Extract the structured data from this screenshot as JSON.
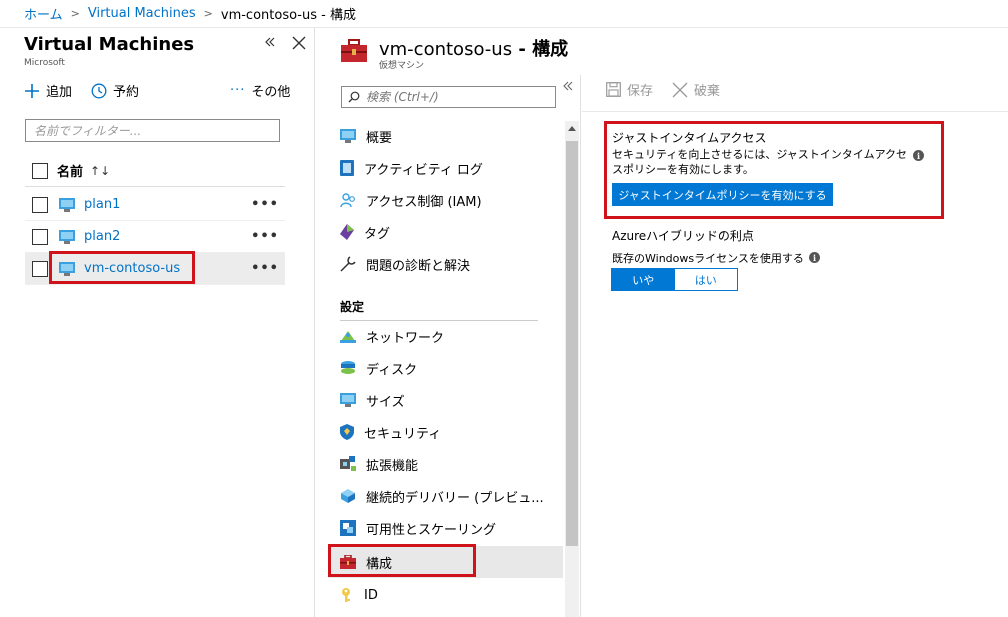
{
  "breadcrumb": {
    "home": "ホーム",
    "vms": "Virtual Machines",
    "current": "vm-contoso-us  - 構成"
  },
  "left_blade": {
    "title": "Virtual Machines",
    "subtitle": "Microsoft",
    "add_label": "追加",
    "reserve_label": "予約",
    "more_label": "その他",
    "filter_placeholder": "名前でフィルター...",
    "column_header": "名前",
    "rows": [
      {
        "name": "plan1",
        "more": "•••"
      },
      {
        "name": "plan2",
        "more": "•••"
      },
      {
        "name": "vm-contoso-us",
        "more": "•••"
      }
    ]
  },
  "resource": {
    "title_name": "vm-contoso-us",
    "title_suffix": " - 構成",
    "subtitle": "仮想マシン"
  },
  "nav": {
    "search_placeholder": "検索 (Ctrl+/)",
    "items": [
      {
        "label": "概要",
        "icon": "monitor-icon"
      },
      {
        "label": "アクティビティ ログ",
        "icon": "log-icon"
      },
      {
        "label": "アクセス制御 (IAM)",
        "icon": "people-icon"
      },
      {
        "label": "タグ",
        "icon": "tag-icon"
      },
      {
        "label": "問題の診断と解決",
        "icon": "wrench-icon"
      }
    ],
    "section_label": "設定",
    "settings": [
      {
        "label": "ネットワーク",
        "icon": "network-icon"
      },
      {
        "label": "ディスク",
        "icon": "disk-icon"
      },
      {
        "label": "サイズ",
        "icon": "monitor-icon"
      },
      {
        "label": "セキュリティ",
        "icon": "shield-icon"
      },
      {
        "label": "拡張機能",
        "icon": "extension-icon"
      },
      {
        "label": "継続的デリバリー (プレビュ...",
        "icon": "delivery-icon"
      },
      {
        "label": "可用性とスケーリング",
        "icon": "scale-icon"
      },
      {
        "label": "構成",
        "icon": "toolbox-icon"
      },
      {
        "label": "ID",
        "icon": "key-icon"
      }
    ]
  },
  "toolbar": {
    "save_label": "保存",
    "discard_label": "破棄"
  },
  "content": {
    "jit_title": "ジャストインタイムアクセス",
    "jit_description": "セキュリティを向上させるには、ジャストインタイムアクセスポリシーを有効にします。",
    "jit_button": "ジャストインタイムポリシーを有効にする",
    "hybrid_title": "Azureハイブリッドの利点",
    "license_label": "既存のWindowsライセンスを使用する",
    "toggle_no": "いや",
    "toggle_yes": "はい"
  },
  "colors": {
    "accent": "#0078d4",
    "link": "#0072c6",
    "highlight": "#d0121b"
  }
}
